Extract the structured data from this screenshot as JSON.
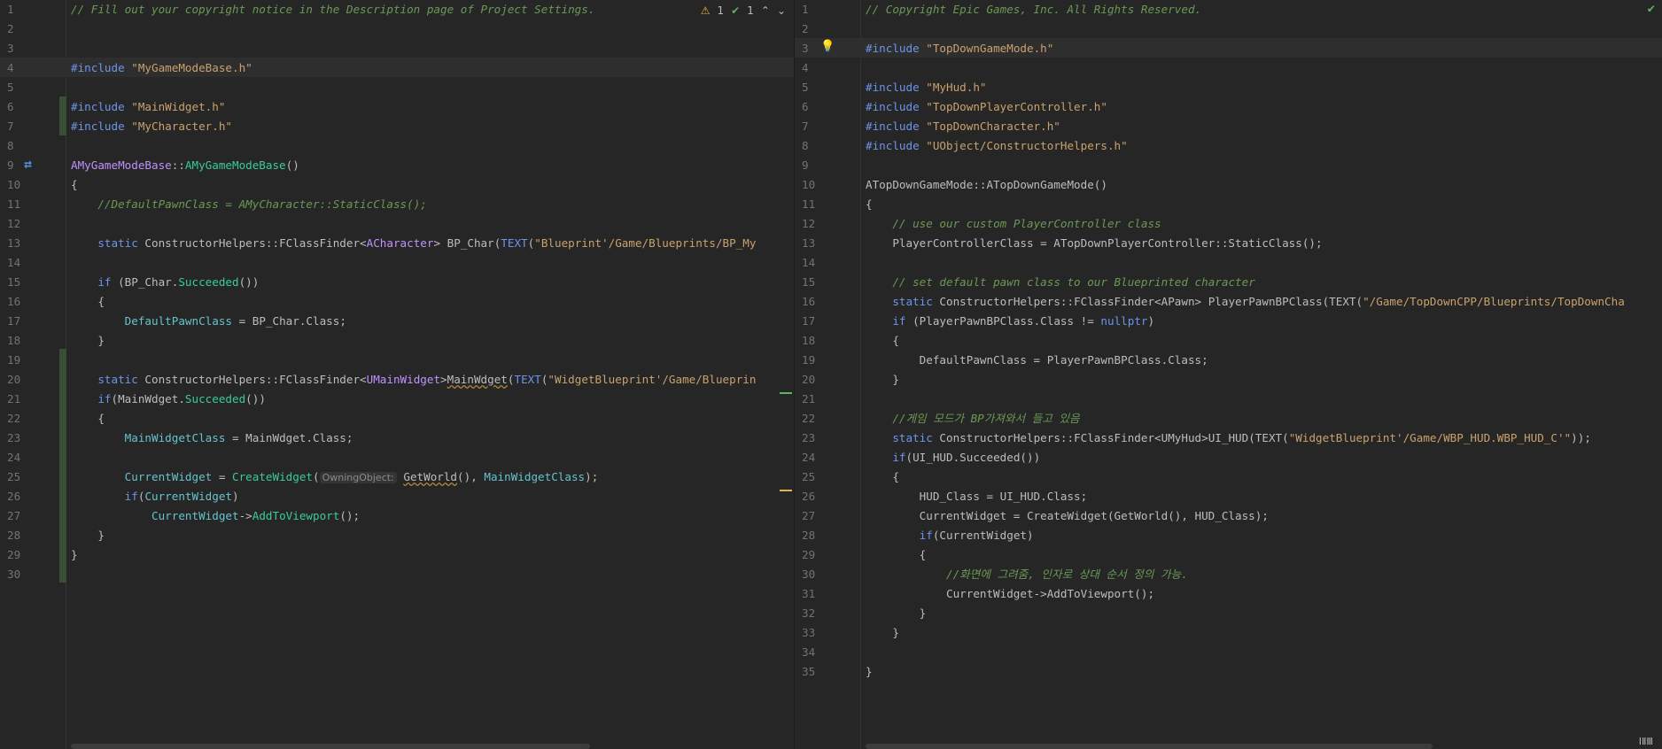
{
  "left": {
    "inspection": {
      "warnings": "1",
      "ok": "1",
      "up": "⌃",
      "down": "⌄"
    },
    "lines": [
      {
        "n": "1",
        "parts": [
          {
            "c": "cm",
            "t": "// Fill out your copyright notice in the Description page of Project Settings."
          }
        ]
      },
      {
        "n": "2",
        "parts": []
      },
      {
        "n": "3",
        "parts": []
      },
      {
        "n": "4",
        "parts": [
          {
            "c": "kw",
            "t": "#include "
          },
          {
            "c": "st",
            "t": "\"MyGameModeBase.h\""
          }
        ]
      },
      {
        "n": "5",
        "parts": []
      },
      {
        "n": "6",
        "parts": [
          {
            "c": "kw",
            "t": "#include "
          },
          {
            "c": "st",
            "t": "\"MainWidget.h\""
          }
        ]
      },
      {
        "n": "7",
        "parts": [
          {
            "c": "kw",
            "t": "#include "
          },
          {
            "c": "st",
            "t": "\"MyCharacter.h\""
          }
        ]
      },
      {
        "n": "8",
        "parts": []
      },
      {
        "n": "9",
        "parts": [
          {
            "c": "ty",
            "t": "AMyGameModeBase"
          },
          {
            "c": "",
            "t": "::"
          },
          {
            "c": "fn",
            "t": "AMyGameModeBase"
          },
          {
            "c": "",
            "t": "()"
          }
        ]
      },
      {
        "n": "10",
        "parts": [
          {
            "c": "",
            "t": "{"
          }
        ]
      },
      {
        "n": "11",
        "parts": [
          {
            "c": "",
            "t": "    "
          },
          {
            "c": "cm",
            "t": "//DefaultPawnClass = AMyCharacter::StaticClass();"
          }
        ]
      },
      {
        "n": "12",
        "parts": []
      },
      {
        "n": "13",
        "parts": [
          {
            "c": "",
            "t": "    "
          },
          {
            "c": "kw",
            "t": "static "
          },
          {
            "c": "",
            "t": "ConstructorHelpers::FClassFinder<"
          },
          {
            "c": "ty",
            "t": "ACharacter"
          },
          {
            "c": "",
            "t": "> BP_Char("
          },
          {
            "c": "kw",
            "t": "TEXT"
          },
          {
            "c": "",
            "t": "("
          },
          {
            "c": "st",
            "t": "\"Blueprint'/Game/Blueprints/BP_My"
          }
        ]
      },
      {
        "n": "14",
        "parts": []
      },
      {
        "n": "15",
        "parts": [
          {
            "c": "",
            "t": "    "
          },
          {
            "c": "kw",
            "t": "if "
          },
          {
            "c": "",
            "t": "(BP_Char."
          },
          {
            "c": "fn",
            "t": "Succeeded"
          },
          {
            "c": "",
            "t": "())"
          }
        ]
      },
      {
        "n": "16",
        "parts": [
          {
            "c": "",
            "t": "    {"
          }
        ]
      },
      {
        "n": "17",
        "parts": [
          {
            "c": "",
            "t": "        "
          },
          {
            "c": "mc",
            "t": "DefaultPawnClass"
          },
          {
            "c": "",
            "t": " = BP_Char.Class;"
          }
        ]
      },
      {
        "n": "18",
        "parts": [
          {
            "c": "",
            "t": "    }"
          }
        ]
      },
      {
        "n": "19",
        "parts": []
      },
      {
        "n": "20",
        "parts": [
          {
            "c": "",
            "t": "    "
          },
          {
            "c": "kw",
            "t": "static "
          },
          {
            "c": "",
            "t": "ConstructorHelpers::FClassFinder<"
          },
          {
            "c": "ty",
            "t": "UMainWidget"
          },
          {
            "c": "",
            "t": ">"
          },
          {
            "c": "wavy",
            "t": "MainWdget"
          },
          {
            "c": "",
            "t": "("
          },
          {
            "c": "kw",
            "t": "TEXT"
          },
          {
            "c": "",
            "t": "("
          },
          {
            "c": "st",
            "t": "\"WidgetBlueprint'/Game/Blueprin"
          }
        ]
      },
      {
        "n": "21",
        "parts": [
          {
            "c": "",
            "t": "    "
          },
          {
            "c": "kw",
            "t": "if"
          },
          {
            "c": "",
            "t": "(MainWdget."
          },
          {
            "c": "fn",
            "t": "Succeeded"
          },
          {
            "c": "",
            "t": "())"
          }
        ]
      },
      {
        "n": "22",
        "parts": [
          {
            "c": "",
            "t": "    {"
          }
        ]
      },
      {
        "n": "23",
        "parts": [
          {
            "c": "",
            "t": "        "
          },
          {
            "c": "mc",
            "t": "MainWidgetClass"
          },
          {
            "c": "",
            "t": " = MainWdget.Class;"
          }
        ]
      },
      {
        "n": "24",
        "parts": []
      },
      {
        "n": "25",
        "parts": [
          {
            "c": "",
            "t": "        "
          },
          {
            "c": "mc",
            "t": "CurrentWidget"
          },
          {
            "c": "",
            "t": " = "
          },
          {
            "c": "fn",
            "t": "CreateWidget"
          },
          {
            "c": "",
            "t": "("
          },
          {
            "c": "hint",
            "t": "OwningObject:"
          },
          {
            "c": "",
            "t": " "
          },
          {
            "c": "wavy",
            "t": "GetWorld"
          },
          {
            "c": "",
            "t": "(), "
          },
          {
            "c": "mc",
            "t": "MainWidgetClass"
          },
          {
            "c": "",
            "t": ");"
          }
        ]
      },
      {
        "n": "26",
        "parts": [
          {
            "c": "",
            "t": "        "
          },
          {
            "c": "kw",
            "t": "if"
          },
          {
            "c": "",
            "t": "("
          },
          {
            "c": "mc",
            "t": "CurrentWidget"
          },
          {
            "c": "",
            "t": ")"
          }
        ]
      },
      {
        "n": "27",
        "parts": [
          {
            "c": "",
            "t": "            "
          },
          {
            "c": "mc",
            "t": "CurrentWidget"
          },
          {
            "c": "",
            "t": "->"
          },
          {
            "c": "fn",
            "t": "AddToViewport"
          },
          {
            "c": "",
            "t": "();"
          }
        ]
      },
      {
        "n": "28",
        "parts": [
          {
            "c": "",
            "t": "    }"
          }
        ]
      },
      {
        "n": "29",
        "parts": [
          {
            "c": "",
            "t": "}"
          }
        ]
      },
      {
        "n": "30",
        "parts": []
      }
    ]
  },
  "right": {
    "lines": [
      {
        "n": "1",
        "parts": [
          {
            "c": "cm",
            "t": "// Copyright Epic Games, Inc. All Rights Reserved."
          }
        ]
      },
      {
        "n": "2",
        "parts": []
      },
      {
        "n": "3",
        "parts": [
          {
            "c": "kw",
            "t": "#include "
          },
          {
            "c": "st",
            "t": "\"TopDownGameMode.h\""
          }
        ]
      },
      {
        "n": "4",
        "parts": []
      },
      {
        "n": "5",
        "parts": [
          {
            "c": "kw",
            "t": "#include "
          },
          {
            "c": "st",
            "t": "\"MyHud.h\""
          }
        ]
      },
      {
        "n": "6",
        "parts": [
          {
            "c": "kw",
            "t": "#include "
          },
          {
            "c": "st",
            "t": "\"TopDownPlayerController.h\""
          }
        ]
      },
      {
        "n": "7",
        "parts": [
          {
            "c": "kw",
            "t": "#include "
          },
          {
            "c": "st",
            "t": "\"TopDownCharacter.h\""
          }
        ]
      },
      {
        "n": "8",
        "parts": [
          {
            "c": "kw",
            "t": "#include "
          },
          {
            "c": "st",
            "t": "\"UObject/ConstructorHelpers.h\""
          }
        ]
      },
      {
        "n": "9",
        "parts": []
      },
      {
        "n": "10",
        "parts": [
          {
            "c": "",
            "t": "ATopDownGameMode::ATopDownGameMode()"
          }
        ]
      },
      {
        "n": "11",
        "parts": [
          {
            "c": "",
            "t": "{"
          }
        ]
      },
      {
        "n": "12",
        "parts": [
          {
            "c": "",
            "t": "    "
          },
          {
            "c": "cm",
            "t": "// use our custom PlayerController class"
          }
        ]
      },
      {
        "n": "13",
        "parts": [
          {
            "c": "",
            "t": "    PlayerControllerClass = ATopDownPlayerController::StaticClass();"
          }
        ]
      },
      {
        "n": "14",
        "parts": []
      },
      {
        "n": "15",
        "parts": [
          {
            "c": "",
            "t": "    "
          },
          {
            "c": "cm",
            "t": "// set default pawn class to our Blueprinted character"
          }
        ]
      },
      {
        "n": "16",
        "parts": [
          {
            "c": "",
            "t": "    "
          },
          {
            "c": "kw",
            "t": "static "
          },
          {
            "c": "",
            "t": "ConstructorHelpers::FClassFinder<APawn> PlayerPawnBPClass(TEXT("
          },
          {
            "c": "st",
            "t": "\"/Game/TopDownCPP/Blueprints/TopDownCha"
          }
        ]
      },
      {
        "n": "17",
        "parts": [
          {
            "c": "",
            "t": "    "
          },
          {
            "c": "kw",
            "t": "if "
          },
          {
            "c": "",
            "t": "(PlayerPawnBPClass.Class != "
          },
          {
            "c": "kw",
            "t": "nullptr"
          },
          {
            "c": "",
            "t": ")"
          }
        ]
      },
      {
        "n": "18",
        "parts": [
          {
            "c": "",
            "t": "    {"
          }
        ]
      },
      {
        "n": "19",
        "parts": [
          {
            "c": "",
            "t": "        DefaultPawnClass = PlayerPawnBPClass.Class;"
          }
        ]
      },
      {
        "n": "20",
        "parts": [
          {
            "c": "",
            "t": "    }"
          }
        ]
      },
      {
        "n": "21",
        "parts": []
      },
      {
        "n": "22",
        "parts": [
          {
            "c": "",
            "t": "    "
          },
          {
            "c": "cm",
            "t": "//게임 모드가 BP가져와서 들고 있음"
          }
        ]
      },
      {
        "n": "23",
        "parts": [
          {
            "c": "",
            "t": "    "
          },
          {
            "c": "kw",
            "t": "static "
          },
          {
            "c": "",
            "t": "ConstructorHelpers::FClassFinder<UMyHud>UI_HUD(TEXT("
          },
          {
            "c": "st",
            "t": "\"WidgetBlueprint'/Game/WBP_HUD.WBP_HUD_C'\""
          },
          {
            "c": "",
            "t": "));"
          }
        ]
      },
      {
        "n": "24",
        "parts": [
          {
            "c": "",
            "t": "    "
          },
          {
            "c": "kw",
            "t": "if"
          },
          {
            "c": "",
            "t": "(UI_HUD.Succeeded())"
          }
        ]
      },
      {
        "n": "25",
        "parts": [
          {
            "c": "",
            "t": "    {"
          }
        ]
      },
      {
        "n": "26",
        "parts": [
          {
            "c": "",
            "t": "        HUD_Class = UI_HUD.Class;"
          }
        ]
      },
      {
        "n": "27",
        "parts": [
          {
            "c": "",
            "t": "        CurrentWidget = CreateWidget(GetWorld(), HUD_Class);"
          }
        ]
      },
      {
        "n": "28",
        "parts": [
          {
            "c": "",
            "t": "        "
          },
          {
            "c": "kw",
            "t": "if"
          },
          {
            "c": "",
            "t": "(CurrentWidget)"
          }
        ]
      },
      {
        "n": "29",
        "parts": [
          {
            "c": "",
            "t": "        {"
          }
        ]
      },
      {
        "n": "30",
        "parts": [
          {
            "c": "",
            "t": "            "
          },
          {
            "c": "cm",
            "t": "//화면에 그려줌, 인자로 상대 순서 정의 가능."
          }
        ]
      },
      {
        "n": "31",
        "parts": [
          {
            "c": "",
            "t": "            CurrentWidget->AddToViewport();"
          }
        ]
      },
      {
        "n": "32",
        "parts": [
          {
            "c": "",
            "t": "        }"
          }
        ]
      },
      {
        "n": "33",
        "parts": [
          {
            "c": "",
            "t": "    }"
          }
        ]
      },
      {
        "n": "34",
        "parts": []
      },
      {
        "n": "35",
        "parts": [
          {
            "c": "",
            "t": "}"
          }
        ]
      }
    ],
    "status_check": "✔",
    "keyboard_hint": "ⅠⅡⅢ"
  }
}
